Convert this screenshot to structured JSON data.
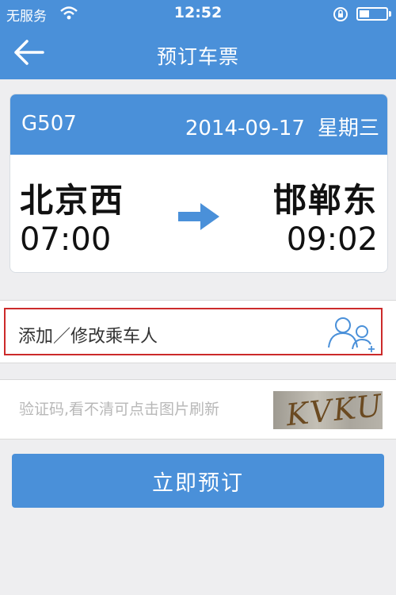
{
  "status": {
    "carrier": "无服务",
    "time": "12:52"
  },
  "nav": {
    "title": "预订车票"
  },
  "ticket": {
    "train_no": "G507",
    "date": "2014-09-17",
    "weekday": "星期三",
    "from_station": "北京西",
    "to_station": "邯郸东",
    "depart_time": "07:00",
    "arrive_time": "09:02"
  },
  "passenger": {
    "label": "添加／修改乘车人"
  },
  "captcha": {
    "placeholder": "验证码,看不清可点击图片刷新",
    "value": "",
    "image_text": "KVKU"
  },
  "submit": {
    "label": "立即预订"
  },
  "colors": {
    "primary": "#4a90d9",
    "highlight": "#cc2a2a",
    "background": "#eeeef0"
  }
}
